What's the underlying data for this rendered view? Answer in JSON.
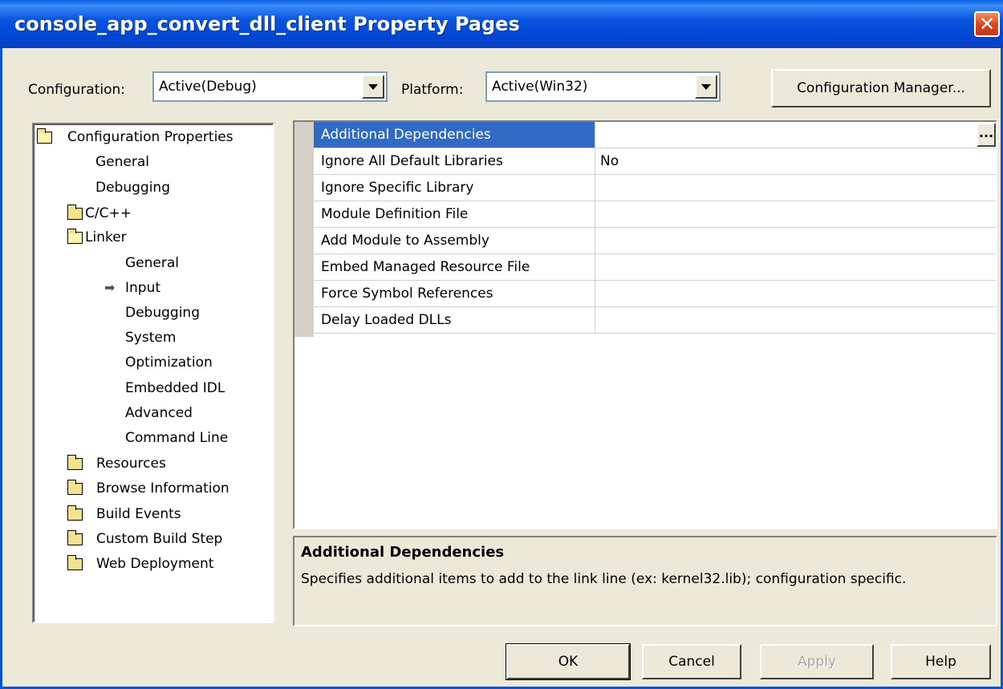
{
  "window": {
    "title": "console_app_convert_dll_client Property Pages"
  },
  "toolbar": {
    "configuration_label": "Configuration:",
    "configuration_value": "Active(Debug)",
    "platform_label": "Platform:",
    "platform_value": "Active(Win32)",
    "config_manager_label": "Configuration Manager..."
  },
  "tree": {
    "root": "Configuration Properties",
    "general": "General",
    "debugging": "Debugging",
    "cpp": "C/C++",
    "linker": "Linker",
    "linker_children": [
      "General",
      "Input",
      "Debugging",
      "System",
      "Optimization",
      "Embedded IDL",
      "Advanced",
      "Command Line"
    ],
    "after": [
      "Resources",
      "Browse Information",
      "Build Events",
      "Custom Build Step",
      "Web Deployment"
    ],
    "selected": "Input"
  },
  "properties": [
    {
      "name": "Additional Dependencies",
      "value": ""
    },
    {
      "name": "Ignore All Default Libraries",
      "value": "No"
    },
    {
      "name": "Ignore Specific Library",
      "value": ""
    },
    {
      "name": "Module Definition File",
      "value": ""
    },
    {
      "name": "Add Module to Assembly",
      "value": ""
    },
    {
      "name": "Embed Managed Resource File",
      "value": ""
    },
    {
      "name": "Force Symbol References",
      "value": ""
    },
    {
      "name": "Delay Loaded DLLs",
      "value": ""
    }
  ],
  "ellipsis_label": "...",
  "description": {
    "title": "Additional Dependencies",
    "text": "Specifies additional items to add to the link line (ex: kernel32.lib); configuration specific."
  },
  "buttons": {
    "ok": "OK",
    "cancel": "Cancel",
    "apply": "Apply",
    "help": "Help"
  },
  "close_glyph": "✕",
  "colors": {
    "titlebar": "#0a55e0",
    "selection": "#316ac5",
    "face": "#ece9d8",
    "close": "#d8461c"
  }
}
